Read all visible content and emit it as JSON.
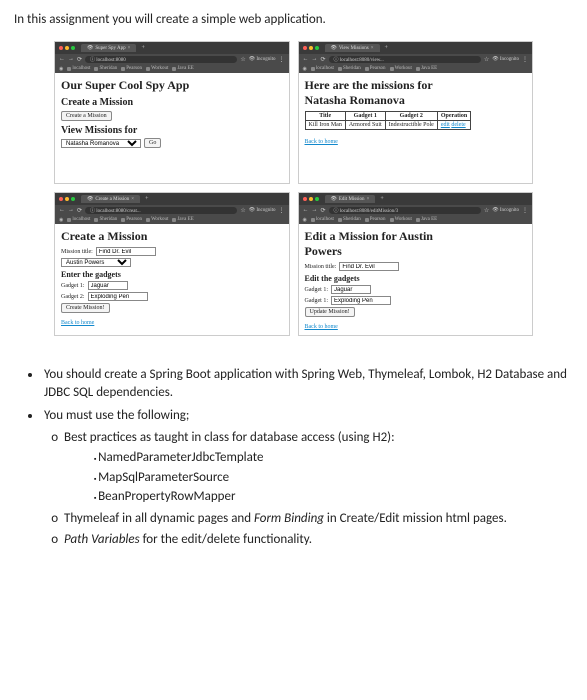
{
  "intro": "In this assignment you will create a simple web application.",
  "chrome": {
    "nav_back": "←",
    "nav_fwd": "→",
    "nav_reload": "⟳",
    "star": "☆",
    "menu": "⋮",
    "incognito_label": "Incognito",
    "bookmarks": [
      "localhost",
      "Sheridan",
      "Pearson",
      "Workout",
      "Java EE"
    ]
  },
  "shot1": {
    "tab_title": "Super Spy App",
    "url": "localhost:8080",
    "h1": "Our Super Cool Spy App",
    "h2_create": "Create a Mission",
    "btn_create": "Create a Mission",
    "h2_view": "View Missions for",
    "select_value": "Natasha Romanova",
    "btn_go": "Go"
  },
  "shot2": {
    "tab_title": "View Missions",
    "url": "localhost:8080/view...",
    "h1a": "Here are the missions for",
    "h1b": "Natasha Romanova",
    "th_title": "Title",
    "th_g1": "Gadget 1",
    "th_g2": "Gadget 2",
    "th_op": "Operation",
    "row_title": "Kill Iron Man",
    "row_g1": "Armored Suit",
    "row_g2": "Indestructible Pole",
    "row_edit": "edit",
    "row_delete": "delete",
    "back": "Back to home"
  },
  "shot3": {
    "tab_title": "Create a Mission",
    "url": "localhost:8080/creat...",
    "h1": "Create a Mission",
    "lbl_title": "Mission title:",
    "title_value": "Find Dr. Evil",
    "agent_value": "Austin Powers",
    "h2_gadgets": "Enter the gadgets",
    "lbl_g1": "Gadget 1:",
    "g1_value": "Jaguar",
    "lbl_g2": "Gadget 2:",
    "g2_value": "Exploding Pen",
    "btn_create": "Create Mission!",
    "back": "Back to home"
  },
  "shot4": {
    "tab_title": "Edit Mission",
    "url": "localhost:8080/editMission/3",
    "h1a": "Edit a Mission for Austin",
    "h1b": "Powers",
    "lbl_title": "Mission title:",
    "title_value": "Find Dr. Evil",
    "h2_gadgets": "Edit the gadgets",
    "lbl_g1": "Gadget 1:",
    "g1_value": "Jaguar",
    "lbl_g2": "Gadget 1:",
    "g2_value": "Exploding Pen",
    "btn_update": "Update Mission!",
    "back": "Back to home"
  },
  "bullets": {
    "b1": "You should create a Spring Boot application with Spring Web, Thymeleaf, Lombok, H2 Database and JDBC SQL dependencies.",
    "b2": "You must use the following;",
    "b2a": "Best practices as taught in class for database access (using H2):",
    "b2a1": "NamedParameterJdbcTemplate",
    "b2a2": "MapSqlParameterSource",
    "b2a3": "BeanPropertyRowMapper",
    "b2b_pre": "Thymeleaf in all dynamic pages and ",
    "b2b_em": "Form Binding",
    "b2b_post": " in Create/Edit mission html pages.",
    "b2c_em": "Path Variables",
    "b2c_post": " for the edit/delete functionality."
  }
}
